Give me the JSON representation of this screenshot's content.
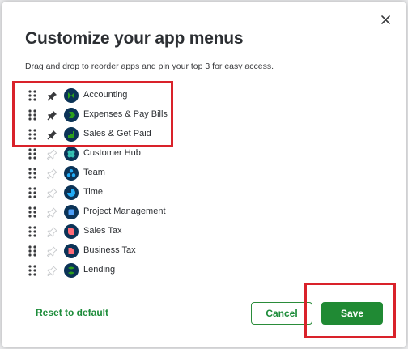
{
  "dialog": {
    "title": "Customize your app menus",
    "subtitle": "Drag and drop to reorder apps and pin your top 3 for easy access."
  },
  "apps": [
    {
      "label": "Accounting",
      "pinned": true,
      "icon": "accounting-icon"
    },
    {
      "label": "Expenses & Pay Bills",
      "pinned": true,
      "icon": "expenses-icon"
    },
    {
      "label": "Sales & Get Paid",
      "pinned": true,
      "icon": "sales-icon"
    },
    {
      "label": "Customer Hub",
      "pinned": false,
      "icon": "customer-hub-icon"
    },
    {
      "label": "Team",
      "pinned": false,
      "icon": "team-icon"
    },
    {
      "label": "Time",
      "pinned": false,
      "icon": "time-icon"
    },
    {
      "label": "Project Management",
      "pinned": false,
      "icon": "project-management-icon"
    },
    {
      "label": "Sales Tax",
      "pinned": false,
      "icon": "sales-tax-icon"
    },
    {
      "label": "Business Tax",
      "pinned": false,
      "icon": "business-tax-icon"
    },
    {
      "label": "Lending",
      "pinned": false,
      "icon": "lending-icon"
    }
  ],
  "footer": {
    "reset_label": "Reset to default",
    "cancel_label": "Cancel",
    "save_label": "Save"
  },
  "colors": {
    "primary_green": "#208a34",
    "link_green": "#1d8c3a",
    "icon_navy": "#0b3357",
    "annotation_red": "#d9222a",
    "pinned_gray": "#393a3d",
    "unpinned_gray": "#c8cacd"
  }
}
